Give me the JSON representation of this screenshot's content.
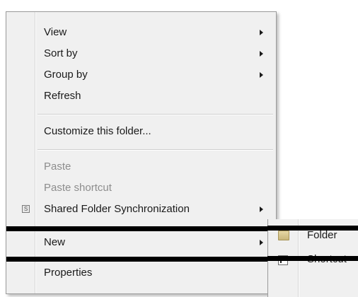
{
  "context_menu": {
    "items": [
      {
        "label": "View",
        "has_submenu": true
      },
      {
        "label": "Sort by",
        "has_submenu": true
      },
      {
        "label": "Group by",
        "has_submenu": true
      },
      {
        "label": "Refresh",
        "has_submenu": false
      },
      {
        "label": "Customize this folder...",
        "has_submenu": false
      },
      {
        "label": "Paste",
        "has_submenu": false,
        "disabled": true
      },
      {
        "label": "Paste shortcut",
        "has_submenu": false,
        "disabled": true
      },
      {
        "label": "Shared Folder Synchronization",
        "has_submenu": true,
        "icon": "sync-icon"
      },
      {
        "label": "New",
        "has_submenu": true,
        "highlighted": true
      },
      {
        "label": "Properties",
        "has_submenu": false
      }
    ]
  },
  "new_submenu": {
    "items": [
      {
        "label": "Folder",
        "icon": "folder-icon"
      },
      {
        "label": "Shortcut",
        "icon": "shortcut-icon"
      }
    ]
  },
  "colors": {
    "menu_bg": "#f0f0f0",
    "highlight_border": "#000000",
    "disabled_text": "#8d8d8d"
  }
}
